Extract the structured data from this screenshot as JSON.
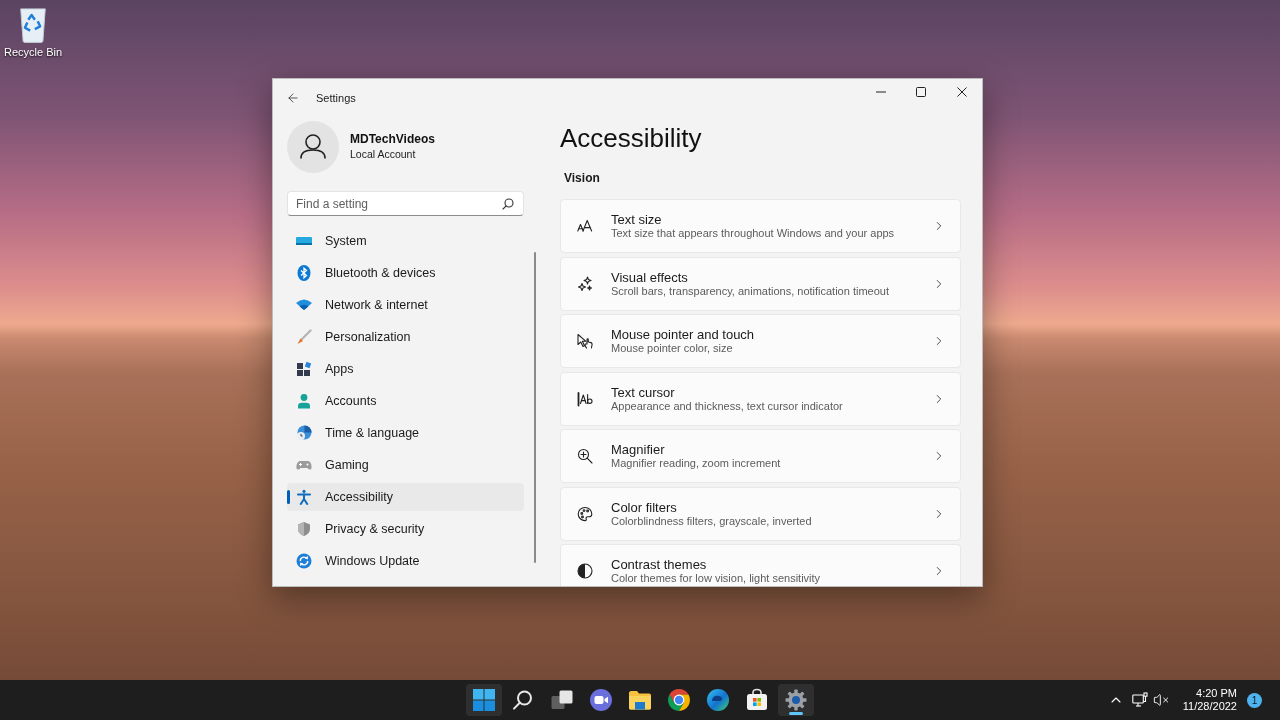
{
  "desktop": {
    "icons": [
      {
        "label": "Recycle Bin"
      }
    ]
  },
  "window": {
    "title": "Settings"
  },
  "profile": {
    "name": "MDTechVideos",
    "account_type": "Local Account"
  },
  "search": {
    "placeholder": "Find a setting"
  },
  "sidebar": {
    "items": [
      {
        "label": "System",
        "selected": false
      },
      {
        "label": "Bluetooth & devices",
        "selected": false
      },
      {
        "label": "Network & internet",
        "selected": false
      },
      {
        "label": "Personalization",
        "selected": false
      },
      {
        "label": "Apps",
        "selected": false
      },
      {
        "label": "Accounts",
        "selected": false
      },
      {
        "label": "Time & language",
        "selected": false
      },
      {
        "label": "Gaming",
        "selected": false
      },
      {
        "label": "Accessibility",
        "selected": true
      },
      {
        "label": "Privacy & security",
        "selected": false
      },
      {
        "label": "Windows Update",
        "selected": false
      }
    ]
  },
  "page": {
    "title": "Accessibility",
    "section": "Vision",
    "cards": [
      {
        "title": "Text size",
        "description": "Text size that appears throughout Windows and your apps"
      },
      {
        "title": "Visual effects",
        "description": "Scroll bars, transparency, animations, notification timeout"
      },
      {
        "title": "Mouse pointer and touch",
        "description": "Mouse pointer color, size"
      },
      {
        "title": "Text cursor",
        "description": "Appearance and thickness, text cursor indicator"
      },
      {
        "title": "Magnifier",
        "description": "Magnifier reading, zoom increment"
      },
      {
        "title": "Color filters",
        "description": "Colorblindness filters, grayscale, inverted"
      },
      {
        "title": "Contrast themes",
        "description": "Color themes for low vision, light sensitivity"
      }
    ]
  },
  "taskbar": {
    "apps": [
      {
        "highlighted": true,
        "active": false
      },
      {
        "highlighted": false,
        "active": false
      },
      {
        "highlighted": false,
        "active": false
      },
      {
        "highlighted": false,
        "active": false
      },
      {
        "highlighted": false,
        "active": false
      },
      {
        "highlighted": false,
        "active": false
      },
      {
        "highlighted": false,
        "active": false
      },
      {
        "highlighted": false,
        "active": false
      },
      {
        "highlighted": true,
        "active": true
      }
    ]
  },
  "tray": {
    "time": "4:20 PM",
    "date": "11/28/2022",
    "notifications": "1"
  }
}
